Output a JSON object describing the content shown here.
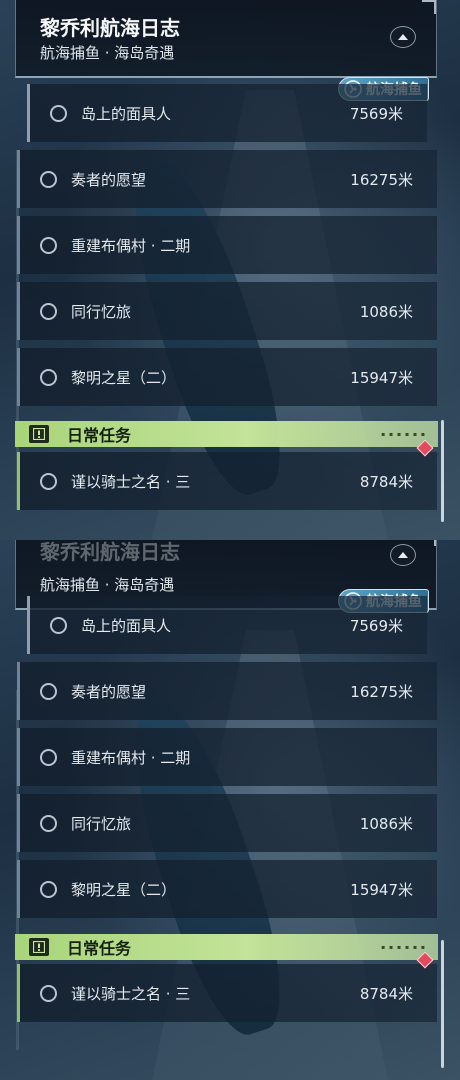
{
  "quest_title": "黎乔利航海日志",
  "quest_subtitle": "航海捕鱼 · 海岛奇遇",
  "badge_label": "航海捕鱼",
  "quests": [
    {
      "name": "岛上的面具人",
      "distance": "7569米"
    },
    {
      "name": "奏者的愿望",
      "distance": "16275米"
    },
    {
      "name": "重建布偶村 · 二期",
      "distance": ""
    },
    {
      "name": "同行忆旅",
      "distance": "1086米"
    },
    {
      "name": "黎明之星（二）",
      "distance": "15947米"
    }
  ],
  "daily": {
    "label": "日常任务",
    "quest": {
      "name": "谨以骑士之名 · 三",
      "distance": "8784米"
    }
  },
  "colors": {
    "daily_accent": "#a9d57a",
    "badge_accent": "#4d93bb",
    "alert_diamond": "#e04c5e"
  }
}
